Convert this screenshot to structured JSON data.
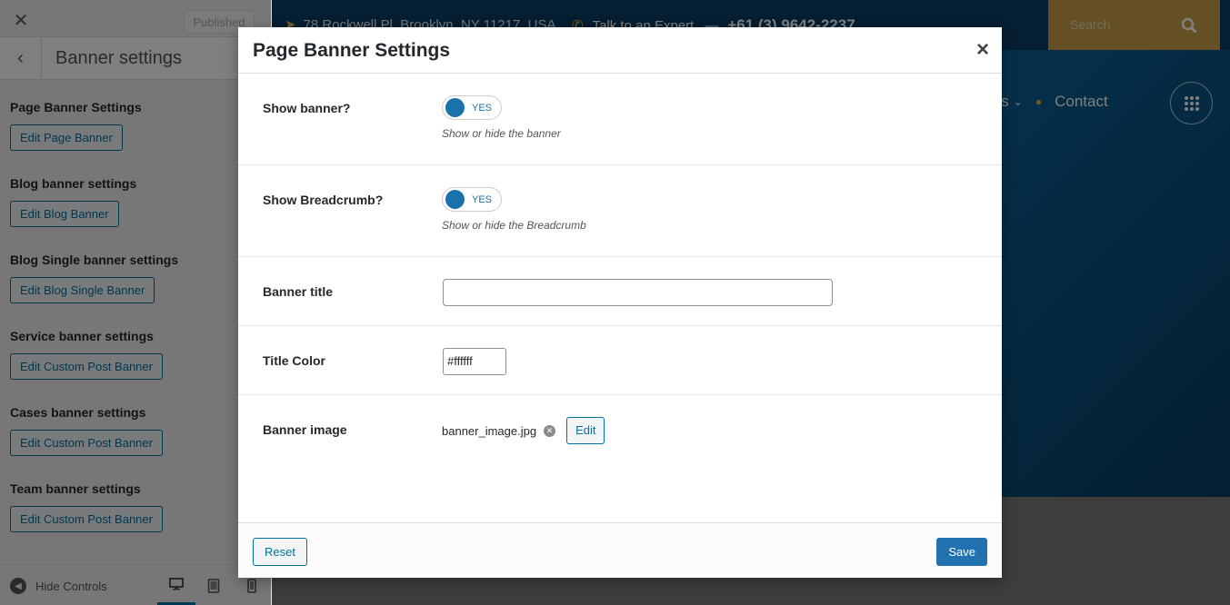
{
  "sidebar": {
    "published_label": "Published",
    "panel_title": "Banner settings",
    "sections": [
      {
        "title": "Page Banner Settings",
        "button": "Edit Page Banner"
      },
      {
        "title": "Blog banner settings",
        "button": "Edit Blog Banner"
      },
      {
        "title": "Blog Single banner settings",
        "button": "Edit Blog Single Banner"
      },
      {
        "title": "Service banner settings",
        "button": "Edit Custom Post Banner"
      },
      {
        "title": "Cases banner settings",
        "button": "Edit Custom Post Banner"
      },
      {
        "title": "Team banner settings",
        "button": "Edit Custom Post Banner"
      }
    ],
    "hide_controls": "Hide Controls"
  },
  "preview": {
    "address": "78 Rockwell Pl, Brooklyn, NY 11217, USA",
    "talk_label": "Talk to an Expert",
    "dash": "—",
    "phone": "+61 (3) 9642-2237",
    "search_placeholder": "Search",
    "nav_partial": "ws",
    "nav_contact": "Contact"
  },
  "modal": {
    "title": "Page Banner Settings",
    "show_banner": {
      "label": "Show banner?",
      "toggle": "YES",
      "desc": "Show or hide the banner"
    },
    "show_breadcrumb": {
      "label": "Show Breadcrumb?",
      "toggle": "YES",
      "desc": "Show or hide the Breadcrumb"
    },
    "banner_title": {
      "label": "Banner title",
      "value": ""
    },
    "title_color": {
      "label": "Title Color",
      "value": "#ffffff"
    },
    "banner_image": {
      "label": "Banner image",
      "file": "banner_image.jpg",
      "edit": "Edit"
    },
    "reset": "Reset",
    "save": "Save"
  },
  "colors": {
    "accent": "#2271b1",
    "link": "#0071a1",
    "hero": "#0b5f93",
    "gold": "#caa14a"
  }
}
